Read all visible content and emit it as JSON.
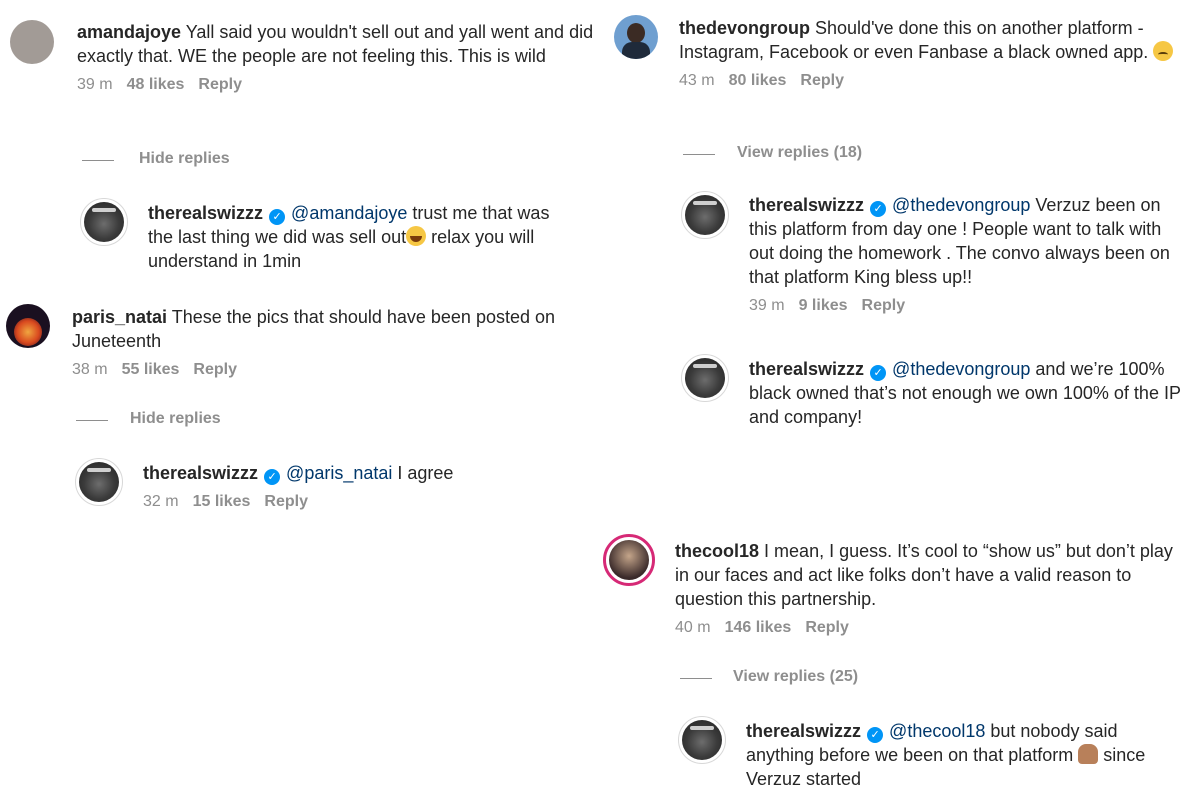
{
  "comments": [
    {
      "username": "amandajoye",
      "text": "Yall said you wouldn't sell out and yall went and did exactly that. WE the people are not feeling this. This is wild",
      "time": "39 m",
      "likes": "48 likes",
      "reply": "Reply",
      "toggle": "Hide replies"
    },
    {
      "username": "therealswizzz",
      "mention": "@amandajoye",
      "text_a": " trust me that was the last thing we did was sell out",
      "text_b": " relax you will understand in 1min"
    },
    {
      "username": "paris_natai",
      "text": "These the pics that should have been posted on Juneteenth",
      "time": "38 m",
      "likes": "55 likes",
      "reply": "Reply",
      "toggle": "Hide replies"
    },
    {
      "username": "therealswizzz",
      "mention": "@paris_natai",
      "text": " I agree",
      "time": "32 m",
      "likes": "15 likes",
      "reply": "Reply"
    },
    {
      "username": "thedevongroup",
      "text": "Should've done this on another platform - Instagram, Facebook or even Fanbase a black owned app.",
      "time": "43 m",
      "likes": "80 likes",
      "reply": "Reply",
      "toggle": "View replies (18)"
    },
    {
      "username": "therealswizzz",
      "mention": "@thedevongroup",
      "text": " Verzuz been on this platform from day one ! People want to talk with out doing the homework . The convo always been on that platform King bless up!!",
      "time": "39 m",
      "likes": "9 likes",
      "reply": "Reply"
    },
    {
      "username": "therealswizzz",
      "mention": "@thedevongroup",
      "text": " and we’re 100% black owned that’s not enough we own 100% of the IP and company!"
    },
    {
      "username": "thecool18",
      "text": "I mean, I guess. It’s cool to “show us” but don’t play in our faces and act like folks don’t have a valid reason to question this partnership.",
      "time": "40 m",
      "likes": "146 likes",
      "reply": "Reply",
      "toggle": "View replies (25)"
    },
    {
      "username": "therealswizzz",
      "mention": "@thecool18",
      "text_a": " but nobody said anything before we been on that platform",
      "text_b": " since Verzuz started"
    }
  ],
  "icons": {
    "verified": "verified-badge-icon",
    "emoji_cry": "crying-face-emoji",
    "emoji_laugh": "tears-of-joy-emoji",
    "emoji_person": "person-emoji"
  },
  "colors": {
    "verified": "#0095f6",
    "mention": "#00376b",
    "meta": "#8e8e8e"
  }
}
